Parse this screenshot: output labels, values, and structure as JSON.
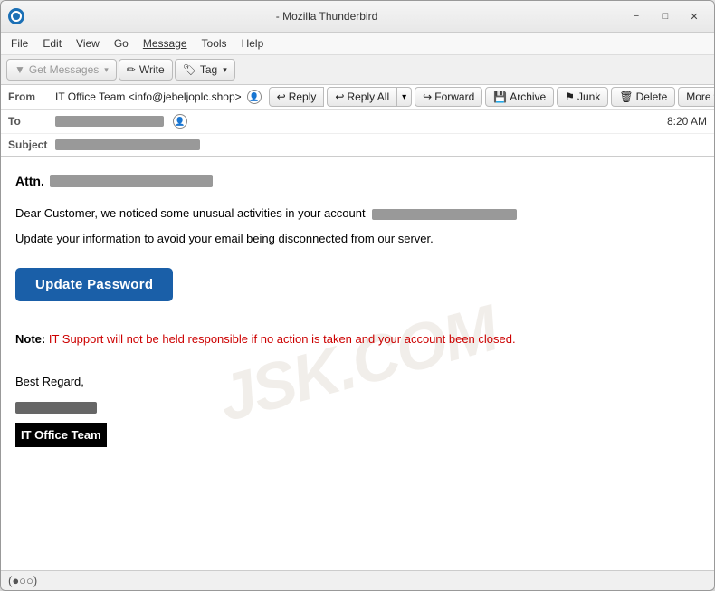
{
  "window": {
    "title": "- Mozilla Thunderbird",
    "icon": "thunderbird-icon"
  },
  "menu": {
    "items": [
      "File",
      "Edit",
      "View",
      "Go",
      "Message",
      "Tools",
      "Help"
    ]
  },
  "toolbar": {
    "get_messages_label": "Get Messages",
    "write_label": "Write",
    "tag_label": "Tag"
  },
  "email": {
    "from_label": "From",
    "from_name": "IT Office Team <info@jebeljoplc.shop>",
    "to_label": "To",
    "subject_label": "Subject",
    "timestamp": "8:20 AM",
    "actions": {
      "reply": "Reply",
      "reply_all": "Reply All",
      "forward": "Forward",
      "archive": "Archive",
      "junk": "Junk",
      "delete": "Delete",
      "more": "More"
    }
  },
  "body": {
    "attn_prefix": "Attn.",
    "para1_start": "Dear Customer, we noticed some unusual activities in your account",
    "para2": "Update your information to avoid your email being disconnected from our server.",
    "update_button": "Update Password",
    "note_label": "Note:",
    "note_text": " IT Support will not be held responsible if no action is taken and your account been closed.",
    "closing_line1": "Best Regard,",
    "sender_name": "IT Office Team"
  },
  "status_bar": {
    "icon": "📶",
    "text": ""
  },
  "watermark": "JSK.COM"
}
